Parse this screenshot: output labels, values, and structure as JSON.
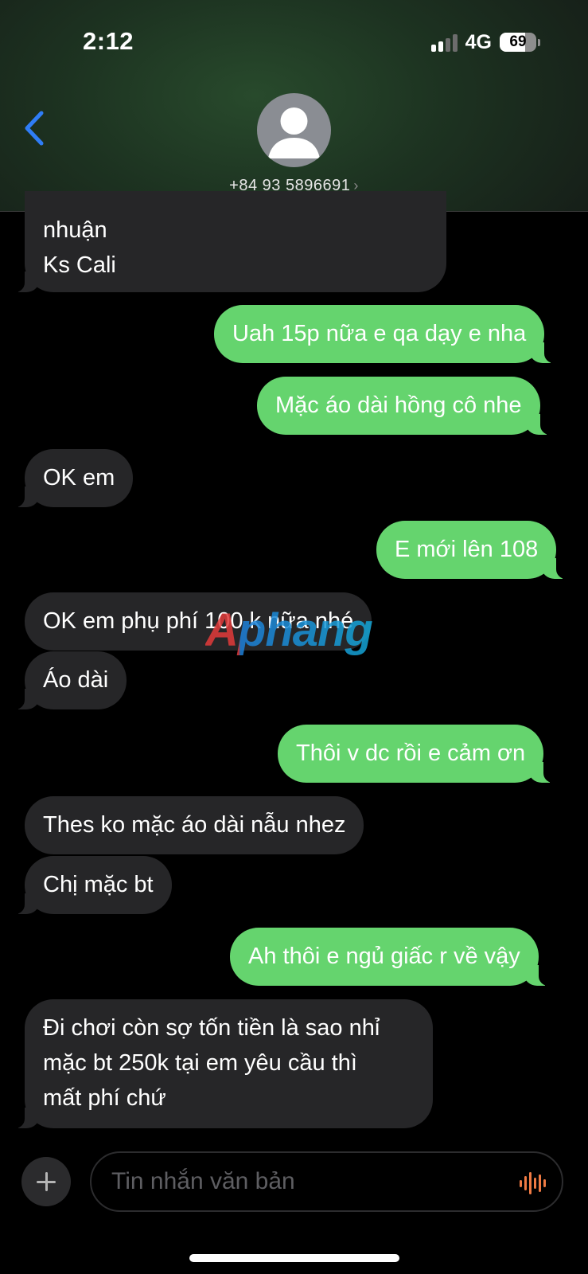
{
  "status_bar": {
    "time": "2:12",
    "network": "4G",
    "battery": "69",
    "battery_level": 0.69
  },
  "header": {
    "contact": "+84 93 5896691"
  },
  "messages": [
    {
      "side": "in",
      "lines": [
        "nhuận",
        "Ks Cali"
      ]
    },
    {
      "side": "out",
      "text": "Uah 15p nữa e qa dạy e nha"
    },
    {
      "side": "out",
      "text": "Mặc áo dài hồng cô nhe"
    },
    {
      "side": "in",
      "text": "OK em"
    },
    {
      "side": "out",
      "text": "E mới lên 108"
    },
    {
      "side": "in",
      "text": "OK em phụ phí 100 k nữa nhé"
    },
    {
      "side": "in",
      "text": "Áo dài"
    },
    {
      "side": "out",
      "text": "Thôi v dc rồi e cảm ơn"
    },
    {
      "side": "in",
      "text": "Thes ko mặc áo dài nẫu nhez"
    },
    {
      "side": "in",
      "text": "Chị mặc bt"
    },
    {
      "side": "out",
      "text": "Ah thôi e ngủ giấc r về vậy"
    },
    {
      "side": "in",
      "lines": [
        "Đi chơi còn sợ tốn tiền là sao nhỉ",
        "mặc bt 250k tại em yêu cầu thì",
        "mất phí chứ"
      ]
    }
  ],
  "watermark": "Aphang",
  "composer": {
    "placeholder": "Tin nhắn văn bản"
  },
  "colors": {
    "incoming": "#262628",
    "outgoing": "#65d46e",
    "back_blue": "#2f7df6",
    "mic": "#ef7a43"
  }
}
